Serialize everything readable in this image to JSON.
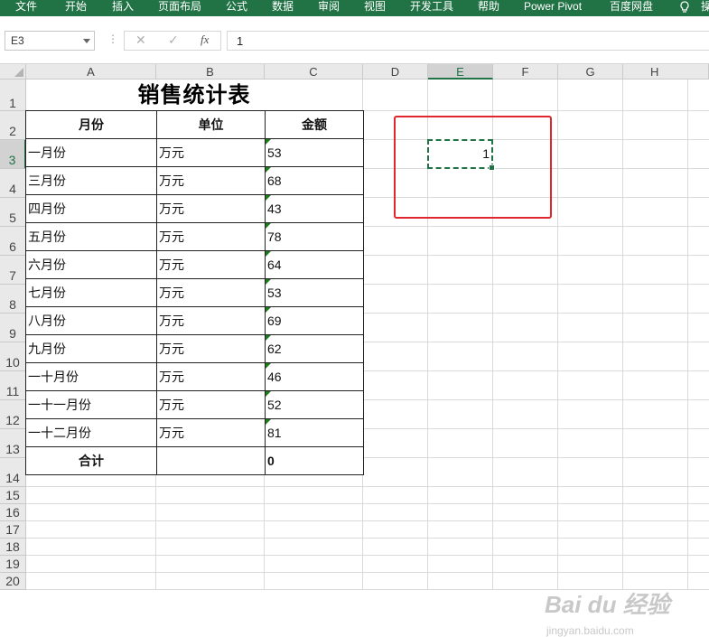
{
  "ribbon": {
    "tabs": [
      "文件",
      "开始",
      "插入",
      "页面布局",
      "公式",
      "数据",
      "审阅",
      "视图",
      "开发工具",
      "帮助",
      "Power Pivot",
      "百度网盘"
    ],
    "overflow_text": "操"
  },
  "formula_bar": {
    "name_box": "E3",
    "cancel_icon": "✕",
    "enter_icon": "✓",
    "fx_label": "fx",
    "value": "1"
  },
  "columns": [
    "A",
    "B",
    "C",
    "D",
    "E",
    "F",
    "G",
    "H"
  ],
  "rows": [
    "1",
    "2",
    "3",
    "4",
    "5",
    "6",
    "7",
    "8",
    "9",
    "10",
    "11",
    "12",
    "13",
    "14",
    "15",
    "16",
    "17",
    "18",
    "19",
    "20"
  ],
  "sheet": {
    "title": "销售统计表",
    "headers": [
      "月份",
      "单位",
      "金额"
    ],
    "records": [
      [
        "一月份",
        "万元",
        "53"
      ],
      [
        "三月份",
        "万元",
        "68"
      ],
      [
        "四月份",
        "万元",
        "43"
      ],
      [
        "五月份",
        "万元",
        "78"
      ],
      [
        "六月份",
        "万元",
        "64"
      ],
      [
        "七月份",
        "万元",
        "53"
      ],
      [
        "八月份",
        "万元",
        "69"
      ],
      [
        "九月份",
        "万元",
        "62"
      ],
      [
        "一十月份",
        "万元",
        "46"
      ],
      [
        "一十一月份",
        "万元",
        "52"
      ],
      [
        "一十二月份",
        "万元",
        "81"
      ]
    ],
    "total": [
      "合计",
      "",
      "0"
    ],
    "selected_cell": "E3",
    "selected_value": "1"
  },
  "watermark": {
    "logo": "Bai du 经验",
    "url": "jingyan.baidu.com"
  },
  "colors": {
    "ribbon": "#217346",
    "highlight_box": "#e0272d",
    "text_number_indicator": "#1e7a1e"
  }
}
